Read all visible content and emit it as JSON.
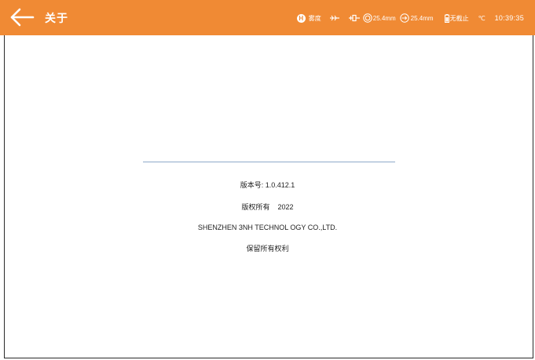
{
  "header": {
    "title": "关于",
    "background_color": "#f08a34"
  },
  "status_bar": {
    "mode_letter": "H",
    "mode_label": "雾度",
    "aperture_value": "25.4mm",
    "port_value": "25.4mm",
    "battery_label": "无截止",
    "temperature_unit": "℃",
    "time": "10:39:35"
  },
  "about": {
    "version": "版本号: 1.0.412.1",
    "copyright": "版权所有    2022",
    "company": "SHENZHEN 3NH TECHNOL OGY CO.,LTD.",
    "rights": "保留所有权利"
  }
}
